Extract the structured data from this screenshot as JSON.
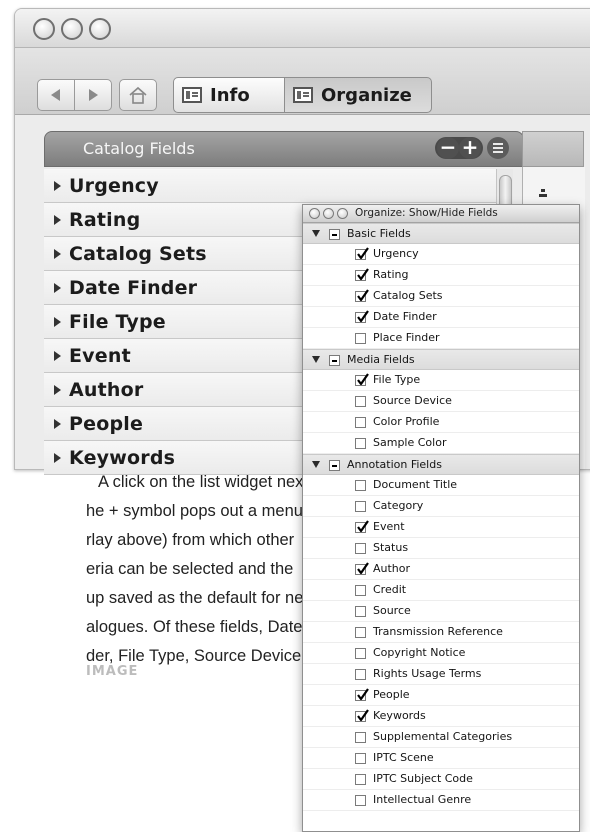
{
  "toolbar": {
    "back": "back-arrow",
    "forward": "forward-arrow",
    "home": "home-icon",
    "info_label": "Info",
    "organize_label": "Organize"
  },
  "catalog_panel": {
    "title": "Catalog Fields",
    "remove_symbol": "−",
    "add_symbol": "+",
    "fields": [
      "Urgency",
      "Rating",
      "Catalog Sets",
      "Date Finder",
      "File Type",
      "Event",
      "Author",
      "People",
      "Keywords"
    ]
  },
  "overlay": {
    "title": "Organize: Show/Hide Fields",
    "groups": [
      {
        "label": "Basic Fields",
        "items": [
          {
            "label": "Urgency",
            "checked": true
          },
          {
            "label": "Rating",
            "checked": true
          },
          {
            "label": "Catalog Sets",
            "checked": true
          },
          {
            "label": "Date Finder",
            "checked": true
          },
          {
            "label": "Place Finder",
            "checked": false
          }
        ]
      },
      {
        "label": "Media Fields",
        "items": [
          {
            "label": "File Type",
            "checked": true
          },
          {
            "label": "Source Device",
            "checked": false
          },
          {
            "label": "Color Profile",
            "checked": false
          },
          {
            "label": "Sample Color",
            "checked": false
          }
        ]
      },
      {
        "label": "Annotation Fields",
        "items": [
          {
            "label": "Document Title",
            "checked": false
          },
          {
            "label": "Category",
            "checked": false
          },
          {
            "label": "Event",
            "checked": true
          },
          {
            "label": "Status",
            "checked": false
          },
          {
            "label": "Author",
            "checked": true
          },
          {
            "label": "Credit",
            "checked": false
          },
          {
            "label": "Source",
            "checked": false
          },
          {
            "label": "Transmission Reference",
            "checked": false
          },
          {
            "label": "Copyright Notice",
            "checked": false
          },
          {
            "label": "Rights Usage Terms",
            "checked": false
          },
          {
            "label": "People",
            "checked": true
          },
          {
            "label": "Keywords",
            "checked": true
          },
          {
            "label": "Supplemental Categories",
            "checked": false
          },
          {
            "label": "IPTC Scene",
            "checked": false
          },
          {
            "label": "IPTC Subject Code",
            "checked": false
          },
          {
            "label": "Intellectual Genre",
            "checked": false
          }
        ]
      }
    ]
  },
  "caption": {
    "lines": [
      "A click on the list widget next",
      "he + symbol pops out a menu",
      "rlay above) from which other",
      "eria can be selected and the",
      "up saved as the default for new",
      "alogues. Of these fields, Date",
      "der, File Type, Source Device,"
    ]
  },
  "footer_label": "IMAGE"
}
